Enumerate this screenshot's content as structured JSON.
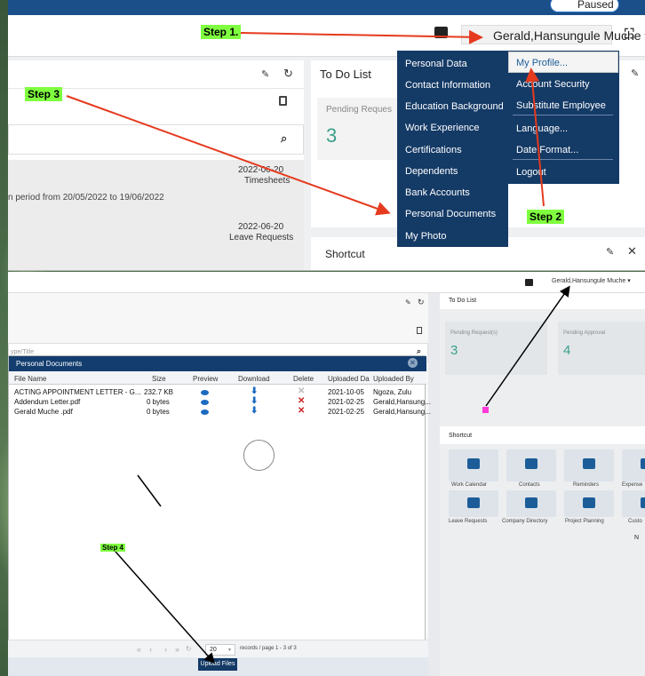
{
  "top_screen": {
    "browser_status": "Paused",
    "user_menu": "Gerald,Hansungule Muche ▾",
    "todo_title": "To Do List",
    "pending_requests_label": "Pending Reques",
    "pending_requests_count": "3",
    "shortcut_title": "Shortcut",
    "rows": [
      {
        "date": "2022-06-20",
        "type": "Timesheets",
        "desc": "n period from 20/05/2022 to 19/06/2022"
      },
      {
        "date": "2022-06-20",
        "type": "Leave Requests",
        "desc": ""
      }
    ],
    "menu_left": [
      "Personal Data",
      "Contact Information",
      "Education Background",
      "Work Experience",
      "Certifications",
      "Dependents",
      "Bank Accounts",
      "Personal Documents",
      "My Photo"
    ],
    "menu_right": [
      "My Profile...",
      "Account Security",
      "Substitute Employee",
      "Language...",
      "Date Format...",
      "Logout"
    ]
  },
  "steps": {
    "step1": "Step 1.",
    "step2": "Step  2",
    "step3": "Step  3",
    "step4": "Step 4"
  },
  "bottom_screen": {
    "user_menu": "Gerald,Hansungule Muche ▾",
    "search_placeholder": "ype/Title",
    "todo_title": "To Do List",
    "pending_requests_label": "Pending Request(s)",
    "pending_requests_count": "3",
    "pending_approval_label": "Pending Approval",
    "pending_approval_count": "4",
    "shortcut_title": "Shortcut",
    "tiles": [
      "Work Calendar",
      "Contacts",
      "Reminders",
      "Expense",
      "Leave Requests",
      "Company Directory",
      "Project Planning",
      "Custo"
    ],
    "more_label": "N",
    "dialog": {
      "title": "Personal Documents",
      "columns": [
        "File Name",
        "Size",
        "Preview",
        "Download",
        "Delete",
        "Uploaded Da",
        "Uploaded By"
      ],
      "rows": [
        {
          "name": "ACTING APPOINTMENT LETTER - G...",
          "size": "232.7 KB",
          "deletable": false,
          "date": "2021-10-05",
          "by": "Ngoza, Zulu"
        },
        {
          "name": "Addendum Letter.pdf",
          "size": "0 bytes",
          "deletable": true,
          "date": "2021-02-25",
          "by": "Gerald,Hansung..."
        },
        {
          "name": "Gerald Muche .pdf",
          "size": "0 bytes",
          "deletable": true,
          "date": "2021-02-25",
          "by": "Gerald,Hansung..."
        }
      ],
      "page_size": "20",
      "records_text": "records / page  1 - 3 of 3",
      "upload_label": "Upload Files"
    }
  },
  "colors": {
    "accent": "#143a66",
    "step": "#7fff3f",
    "arrow": "#e53a1e",
    "teal": "#3aa08a"
  }
}
